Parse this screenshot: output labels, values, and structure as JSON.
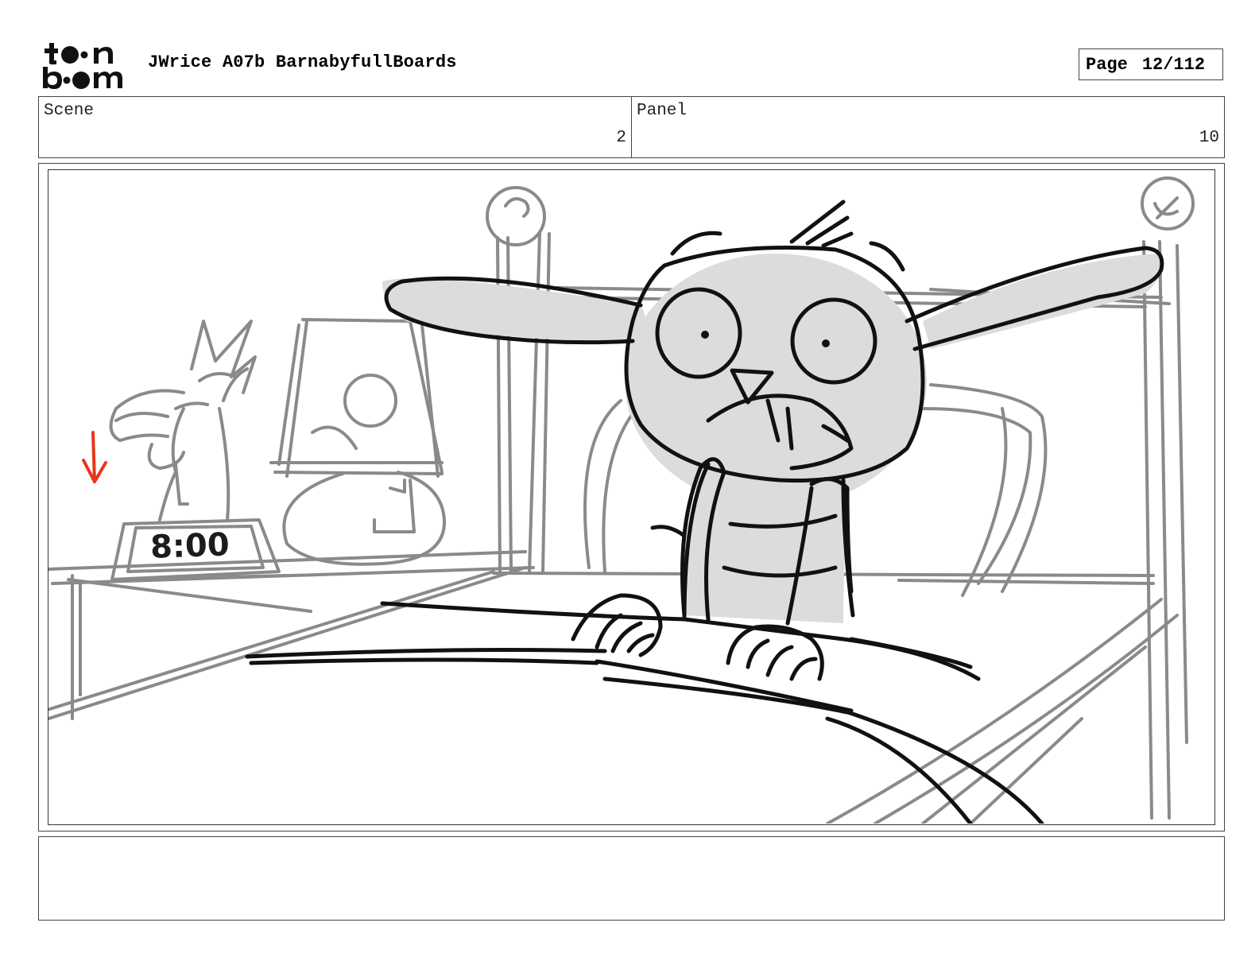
{
  "header": {
    "logo_text": "toon boom",
    "title": "JWrice A07b BarnabyfullBoards",
    "page_label": "Page",
    "page_value": "12/112"
  },
  "info": {
    "scene_label": "Scene",
    "scene_value": "2",
    "panel_label": "Panel",
    "panel_value": "10"
  },
  "panel": {
    "clock_text": "8:00"
  },
  "notes": {
    "text": ""
  },
  "colors": {
    "border": "#444444",
    "sketch_dark": "#111111",
    "sketch_gray": "#8a8a8a",
    "fill_gray": "#dcdcdc",
    "accent_red": "#e8361b"
  }
}
